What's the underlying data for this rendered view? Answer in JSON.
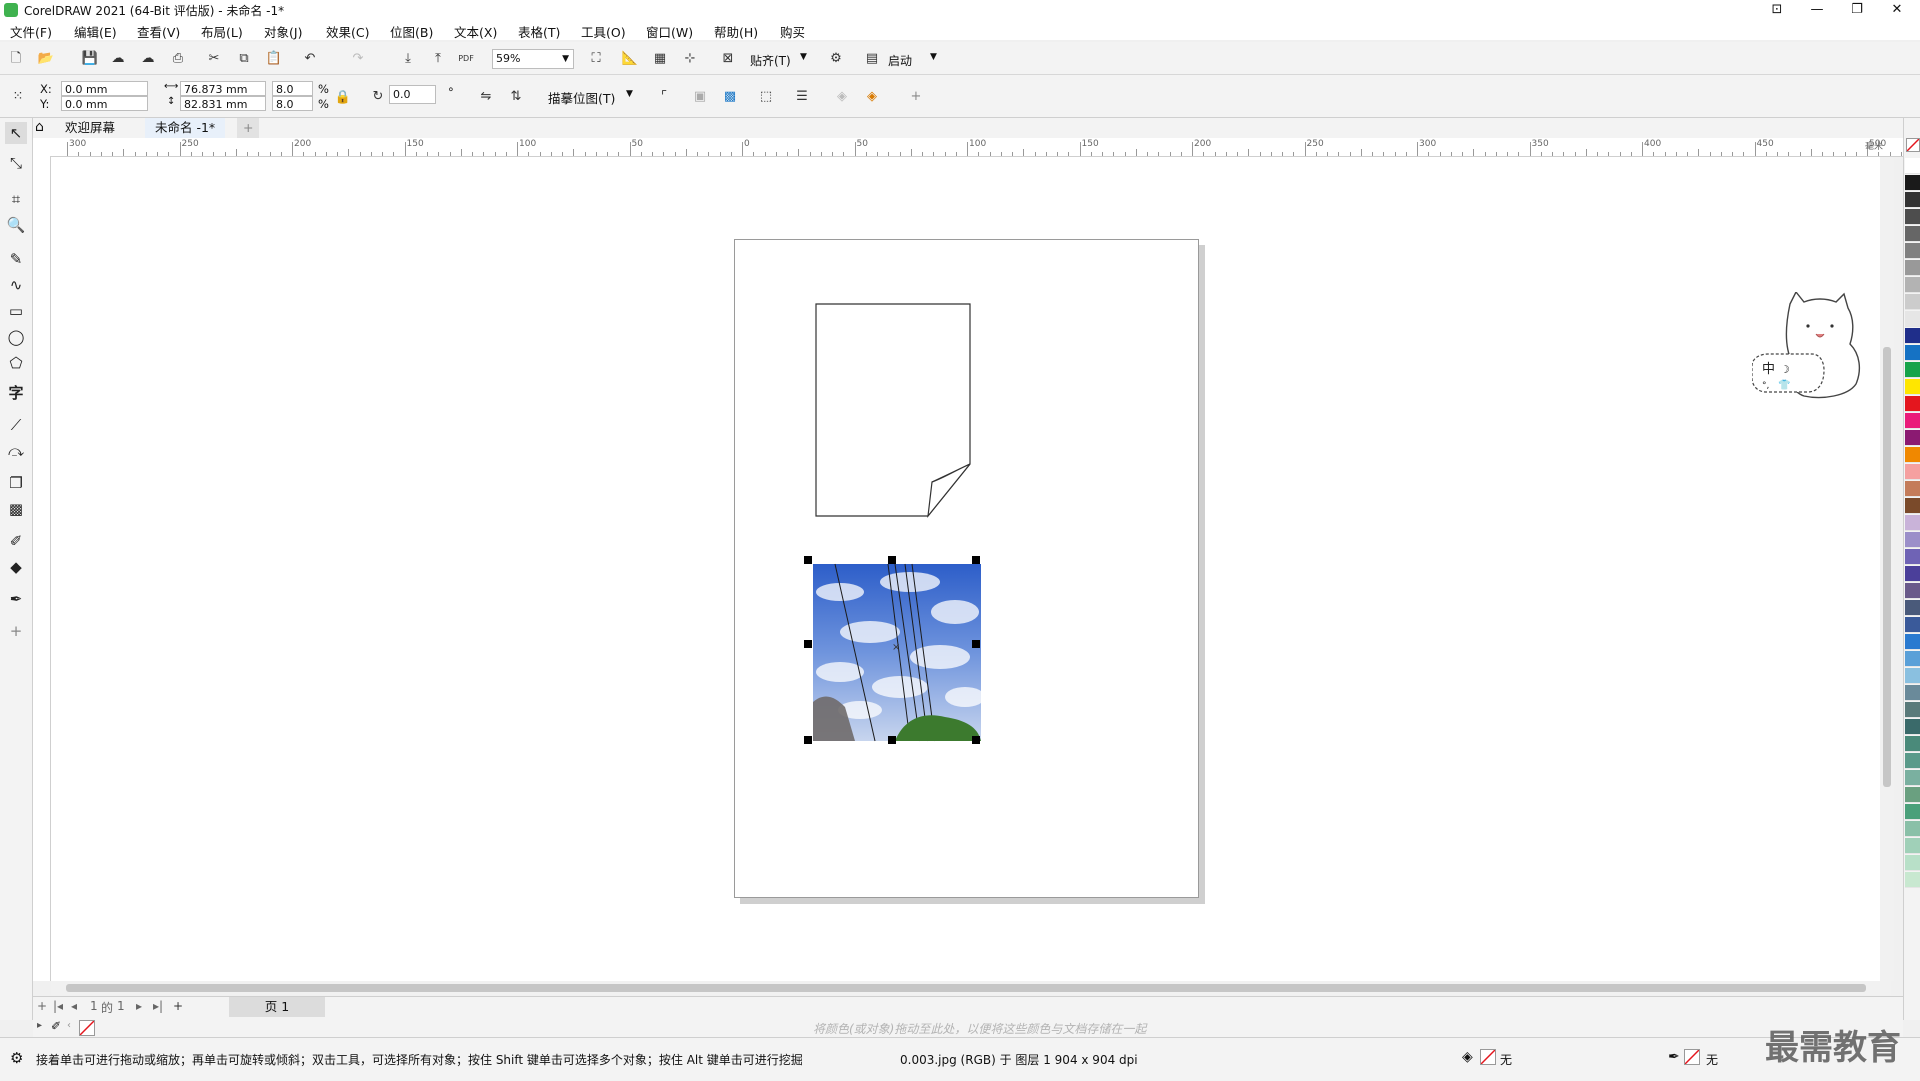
{
  "window": {
    "title": "CorelDRAW 2021 (64-Bit 评估版) - 未命名 -1*",
    "minimize": "—",
    "restore": "❐",
    "close": "✕"
  },
  "menu": [
    "文件(F)",
    "编辑(E)",
    "查看(V)",
    "布局(L)",
    "对象(J)",
    "效果(C)",
    "位图(B)",
    "文本(X)",
    "表格(T)",
    "工具(O)",
    "窗口(W)",
    "帮助(H)",
    "购买"
  ],
  "toolbar": {
    "zoom_value": "59%",
    "snap_label": "贴齐(T)",
    "launch_label": "启动",
    "pdf_label": "PDF"
  },
  "properties": {
    "x_label": "X:",
    "y_label": "Y:",
    "x_value": "0.0 mm",
    "y_value": "0.0 mm",
    "width_value": "76.873 mm",
    "height_value": "82.831 mm",
    "scale_x": "8.0",
    "scale_y": "8.0",
    "percent": "%",
    "rotation": "0.0",
    "degree": "°",
    "trace_label": "描摹位图(T)"
  },
  "tabs": {
    "welcome": "欢迎屏幕",
    "document": "未命名 -1*",
    "add": "+"
  },
  "ruler": {
    "h_ticks": [
      "300",
      "250",
      "200",
      "150",
      "100",
      "50",
      "0",
      "50",
      "100",
      "150",
      "200",
      "250",
      "300",
      "350",
      "400",
      "450",
      "500"
    ],
    "unit": "毫米"
  },
  "pagenav": {
    "current": "1",
    "of": "的",
    "total": "1",
    "page_tab": "页 1"
  },
  "hint": "将颜色(或对象)拖动至此处，以便将这些颜色与文档存储在一起",
  "status": {
    "message": "接着单击可进行拖动或缩放；再单击可旋转或倾斜；双击工具，可选择所有对象；按住 Shift 键单击可选择多个对象；按住 Alt 键单击可进行挖掘",
    "object_info": "0.003.jpg (RGB) 于 图层 1 904 x 904 dpi",
    "fill_none": "无",
    "outline_none": "无"
  },
  "mascot": {
    "badge": "中"
  },
  "watermark": "最需教育",
  "colors": {
    "accent": "#3fb24f",
    "selection": "#2f8fd8",
    "palette": [
      "#ffffff",
      "#1a1a1a",
      "#333333",
      "#4d4d4d",
      "#666666",
      "#808080",
      "#999999",
      "#b3b3b3",
      "#cccccc",
      "#e6e6e6",
      "#1f2e8a",
      "#1572c4",
      "#17a34a",
      "#ffe600",
      "#e4161e",
      "#ea1b7a",
      "#8b1a72",
      "#f08800",
      "#f5a0a0",
      "#c47c5a",
      "#7a4a2a",
      "#c9b3d9",
      "#9b8fc9",
      "#6f63b5",
      "#4b3f9a",
      "#6a5a8a",
      "#4a5a7a",
      "#3a5a9a",
      "#2a7ad0",
      "#5aa0d8",
      "#8ac0e0",
      "#6a8a9a",
      "#5a7a7a",
      "#3a6a6a",
      "#4a8a7a",
      "#5a9a8a",
      "#7ab0a0",
      "#6aa080",
      "#4aa07a",
      "#8ac0a8",
      "#a0d0b8",
      "#b8e0c8",
      "#c8e8d0"
    ]
  }
}
